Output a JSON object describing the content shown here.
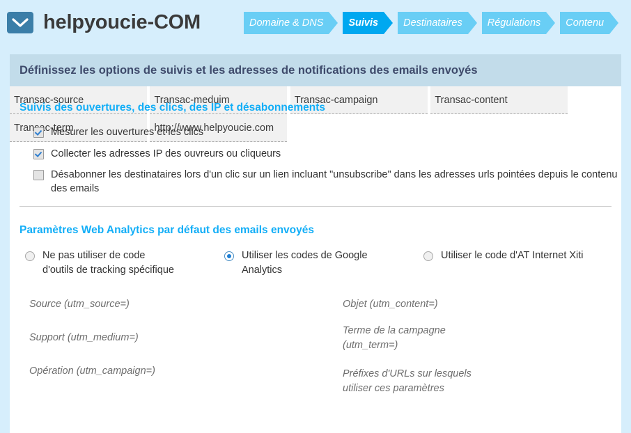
{
  "header": {
    "logo_icon": "envelope-icon",
    "title": "helpyoucie-COM",
    "steps": [
      {
        "label": "Domaine & DNS",
        "active": false
      },
      {
        "label": "Suivis",
        "active": true
      },
      {
        "label": "Destinataires",
        "active": false
      },
      {
        "label": "Régulations",
        "active": false
      },
      {
        "label": "Contenu",
        "active": false
      }
    ]
  },
  "banner": {
    "text": "Définissez les options de suivis et les adresses de notifications des emails envoyés"
  },
  "tracking_section": {
    "title": "Suivis des ouvertures, des clics, des IP et désabonnements",
    "checkboxes": [
      {
        "label": "Mesurer les ouvertures et les clics",
        "checked": true
      },
      {
        "label": "Collecter les adresses IP des ouvreurs ou cliqueurs",
        "checked": true
      },
      {
        "label": "Désabonner les destinataires lors d'un clic sur un lien incluant \"unsubscribe\" dans les adresses urls pointées depuis le contenu des emails",
        "checked": false
      }
    ]
  },
  "analytics_section": {
    "title": "Paramètres Web Analytics par défaut des emails envoyés",
    "radios": [
      {
        "label": "Ne pas utiliser de code d'outils de tracking spécifique",
        "selected": false
      },
      {
        "label": "Utiliser les codes de Google Analytics",
        "selected": true
      },
      {
        "label": "Utiliser le code d'AT Internet Xiti",
        "selected": false
      }
    ],
    "fields_left": [
      {
        "label": "Source (utm_source=)",
        "value": "Transac-source"
      },
      {
        "label": "Support (utm_medium=)",
        "value": "Transac-meduim"
      },
      {
        "label": "Opération (utm_campaign=)",
        "value": "Transac-campaign"
      }
    ],
    "fields_right": [
      {
        "label": "Objet (utm_content=)",
        "value": "Transac-content"
      },
      {
        "label": "Terme de la campagne (utm_term=)",
        "value": "Transac-term"
      },
      {
        "label": "Préfixes d'URLs sur lesquels utiliser ces paramètres",
        "value": "http://www.helpyoucie.com"
      }
    ]
  },
  "colors": {
    "page_background": "#d6eefc",
    "banner_background": "#c2dcea",
    "banner_text": "#3e4a6b",
    "step_inactive": "#69cef5",
    "step_active": "#00a8f0",
    "section_heading": "#12aef7",
    "logo_tile": "#3b7ea8",
    "input_background": "#f1f1f1"
  }
}
